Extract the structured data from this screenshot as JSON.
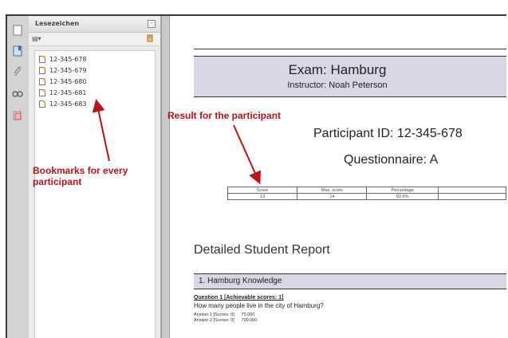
{
  "panel": {
    "title": "Lesezeichen",
    "close_symbol": "-",
    "options_symbol": "▤▾",
    "bookmarks": [
      "12-345-678",
      "12-345-679",
      "12-345-680",
      "12-345-681",
      "12-345-683"
    ]
  },
  "document": {
    "exam_title": "Exam: Hamburg",
    "instructor": "Instructor: Noah Peterson",
    "participant": "Participant ID: 12-345-678",
    "questionnaire": "Questionnaire: A",
    "score_table": {
      "headers": [
        "Score",
        "Max. score",
        "Percentage",
        ""
      ],
      "values": [
        "13",
        "14",
        "92.9%",
        ""
      ]
    },
    "report_title": "Detailed Student Report",
    "section": "1. Hamburg Knowledge",
    "question_title": "Question 1 [Achievable scores: 1]",
    "question_text": "How many people live in the city of Hamburg?",
    "answers": [
      {
        "label": "Answer 1 [Scores: 0]",
        "value": "70.000"
      },
      {
        "label": "Answer 2 [Scores: 0]",
        "value": "700.000"
      }
    ]
  },
  "annotations": {
    "result": "Result for the participant",
    "bookmarks_line1": "Bookmarks for every",
    "bookmarks_line2": "participant"
  },
  "colors": {
    "annotation": "#c0101a",
    "header_band": "#d7d7e6"
  }
}
